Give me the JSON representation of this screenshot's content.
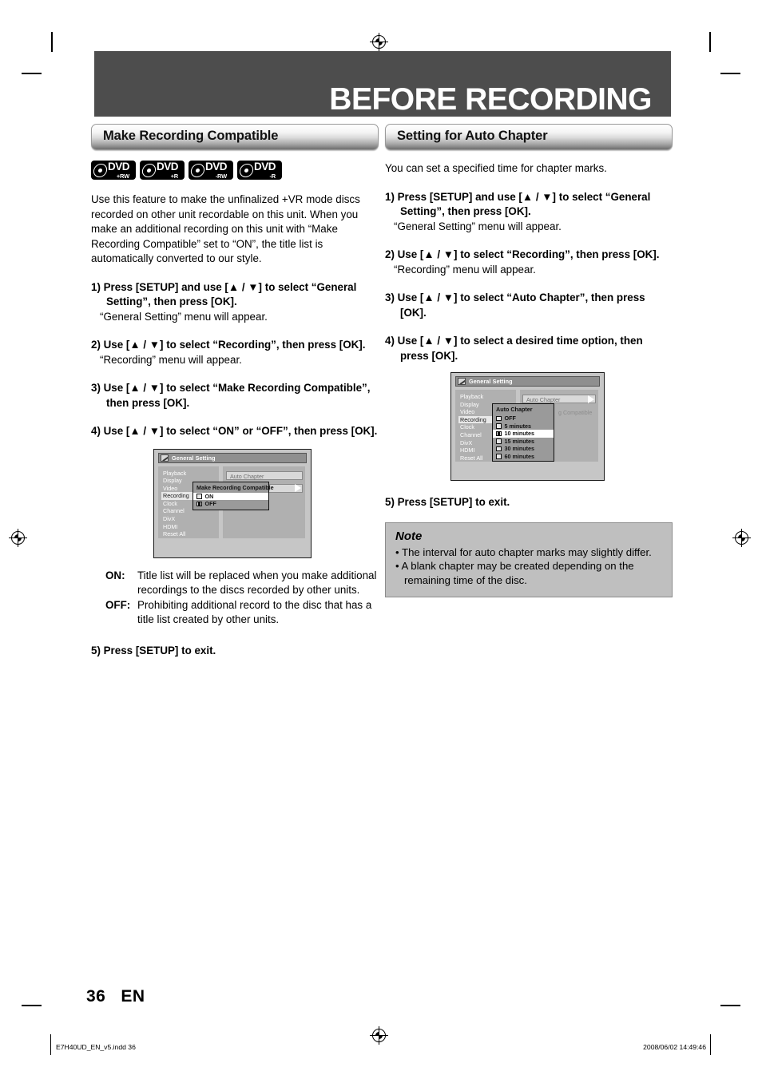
{
  "page": {
    "header_title": "BEFORE RECORDING",
    "page_number": "36",
    "language_code": "EN"
  },
  "left_column": {
    "section_title": "Make Recording Compatible",
    "discs": [
      {
        "main": "DVD",
        "sub": "+RW"
      },
      {
        "main": "DVD",
        "sub": "+R"
      },
      {
        "main": "DVD",
        "sub": "-RW"
      },
      {
        "main": "DVD",
        "sub": "-R"
      }
    ],
    "intro": "Use this feature to make the unfinalized +VR mode discs recorded on other unit recordable on this unit. When you make an additional recording on this unit with “Make Recording Compatible” set to “ON”, the title list is automatically converted to our style.",
    "steps": [
      {
        "head": "1) Press [SETUP] and use [▲ / ▼] to select “General Setting”, then press [OK].",
        "sub": "“General Setting” menu will appear."
      },
      {
        "head": "2) Use [▲ / ▼] to select “Recording”, then press [OK].",
        "sub": "“Recording” menu will appear."
      },
      {
        "head": "3) Use [▲ / ▼] to select “Make Recording Compatible”, then press [OK].",
        "sub": ""
      },
      {
        "head": "4) Use [▲ / ▼] to select “ON” or “OFF”, then press [OK].",
        "sub": ""
      }
    ],
    "screen": {
      "title": "General Setting",
      "nav_items": [
        "Playback",
        "Display",
        "Video",
        "Recording",
        "Clock",
        "Channel",
        "DivX",
        "HDMI",
        "Reset All"
      ],
      "nav_selected": "Recording",
      "option_bar_label": "Auto Chapter",
      "ghost_label": "Compatible",
      "dialog_title": "Make Recording Compatible",
      "dialog_options": [
        {
          "label": "ON",
          "checked": false,
          "highlighted": true
        },
        {
          "label": "OFF",
          "checked": true,
          "highlighted": false
        }
      ]
    },
    "definitions": [
      {
        "term": "ON:",
        "desc": "Title list will be replaced when you make additional recordings to the discs recorded by other units."
      },
      {
        "term": "OFF:",
        "desc": "Prohibiting additional record to the disc that has a title list created by other units."
      }
    ],
    "final_step": "5) Press [SETUP] to exit."
  },
  "right_column": {
    "section_title": "Setting for Auto Chapter",
    "intro": "You can set a specified time for chapter marks.",
    "steps": [
      {
        "head": "1) Press [SETUP] and use [▲ / ▼] to select “General Setting”, then press [OK].",
        "sub": "“General Setting” menu will appear."
      },
      {
        "head": "2) Use [▲ / ▼] to select “Recording”, then press [OK].",
        "sub": "“Recording” menu will appear."
      },
      {
        "head": "3) Use [▲ / ▼] to select “Auto Chapter”, then press [OK].",
        "sub": ""
      },
      {
        "head": "4) Use [▲ / ▼] to select a desired time option, then press [OK].",
        "sub": ""
      }
    ],
    "screen": {
      "title": "General Setting",
      "nav_items": [
        "Playback",
        "Display",
        "Video",
        "Recording",
        "Clock",
        "Channel",
        "DivX",
        "HDMI",
        "Reset All"
      ],
      "nav_selected": "Recording",
      "option_bar_label": "Auto Chapter",
      "ghost_label": "g Compatible",
      "dialog_title": "Auto Chapter",
      "dialog_options": [
        {
          "label": "OFF",
          "checked": false,
          "highlighted": false
        },
        {
          "label": "5 minutes",
          "checked": false,
          "highlighted": false
        },
        {
          "label": "10 minutes",
          "checked": true,
          "highlighted": true
        },
        {
          "label": "15 minutes",
          "checked": false,
          "highlighted": false
        },
        {
          "label": "30 minutes",
          "checked": false,
          "highlighted": false
        },
        {
          "label": "60 minutes",
          "checked": false,
          "highlighted": false
        }
      ]
    },
    "final_step": "5) Press [SETUP] to exit.",
    "note": {
      "title": "Note",
      "items": [
        "• The interval for auto chapter marks may slightly differ.",
        "• A blank chapter may be created depending on the remaining time of the disc."
      ]
    }
  },
  "footer": {
    "file_label": "E7H40UD_EN_v5.indd   36",
    "timestamp": "2008/06/02   14:49:46"
  }
}
